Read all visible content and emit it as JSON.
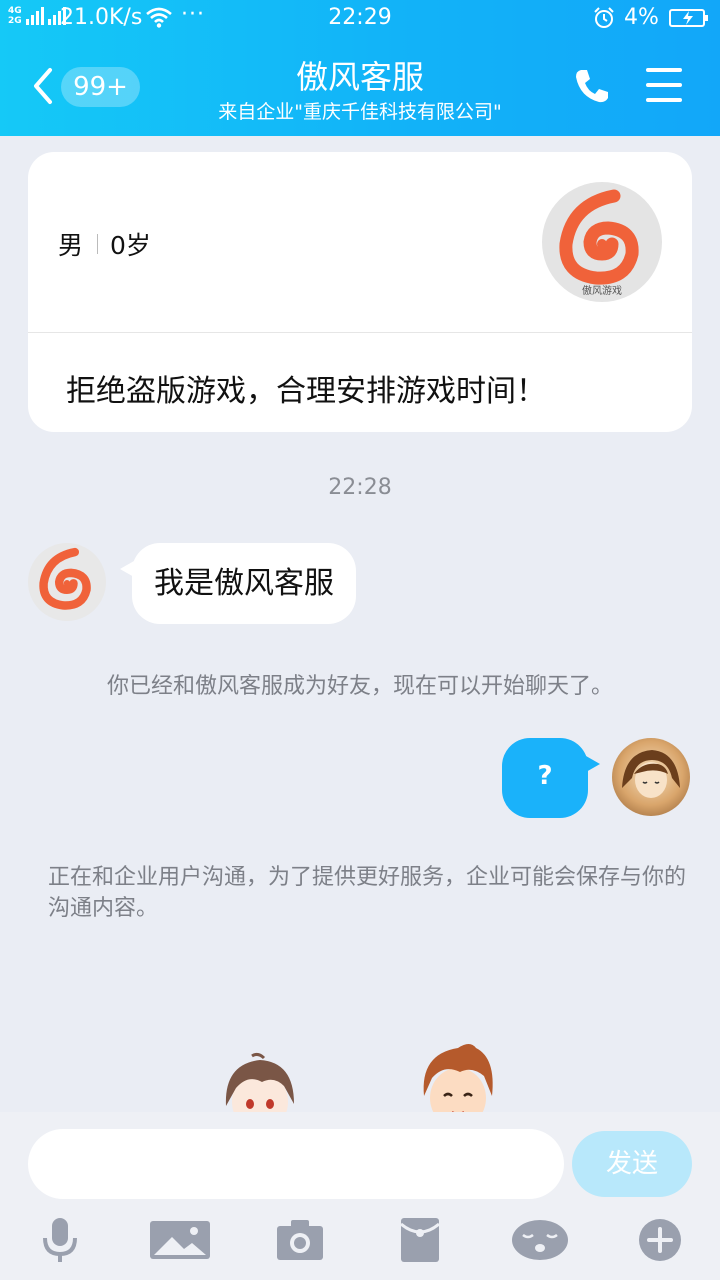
{
  "status": {
    "network_label_top": "4G",
    "network_label_bottom": "2G",
    "speed": "21.0K/s",
    "dots": "···",
    "time": "22:29",
    "battery_percent": "4%"
  },
  "header": {
    "unread_count": "99+",
    "title": "傲风客服",
    "subtitle": "来自企业\"重庆千佳科技有限公司\""
  },
  "profile": {
    "gender": "男",
    "age": "0岁",
    "motto": "拒绝盗版游戏，合理安排游戏时间！",
    "logo_caption": "傲风游戏"
  },
  "chat": {
    "timestamp": "22:28",
    "incoming_message": "我是傲风客服",
    "system_message": "你已经和傲风客服成为好友，现在可以开始聊天了。",
    "outgoing_message": "?",
    "enterprise_notice": "正在和企业用户沟通，为了提供更好服务，企业可能会保存与你的沟通内容。"
  },
  "input": {
    "value": "",
    "send_label": "发送"
  },
  "toolbar_icons": [
    "microphone-icon",
    "image-icon",
    "camera-icon",
    "red-packet-icon",
    "emoji-icon",
    "plus-icon"
  ],
  "colors": {
    "header_start": "#15c9f7",
    "header_end": "#12a7f9",
    "outgoing_bubble": "#1ab2fa",
    "send_disabled": "#b8e8fb",
    "logo_orange": "#f0623a",
    "icon_gray": "#9aa0ae"
  }
}
